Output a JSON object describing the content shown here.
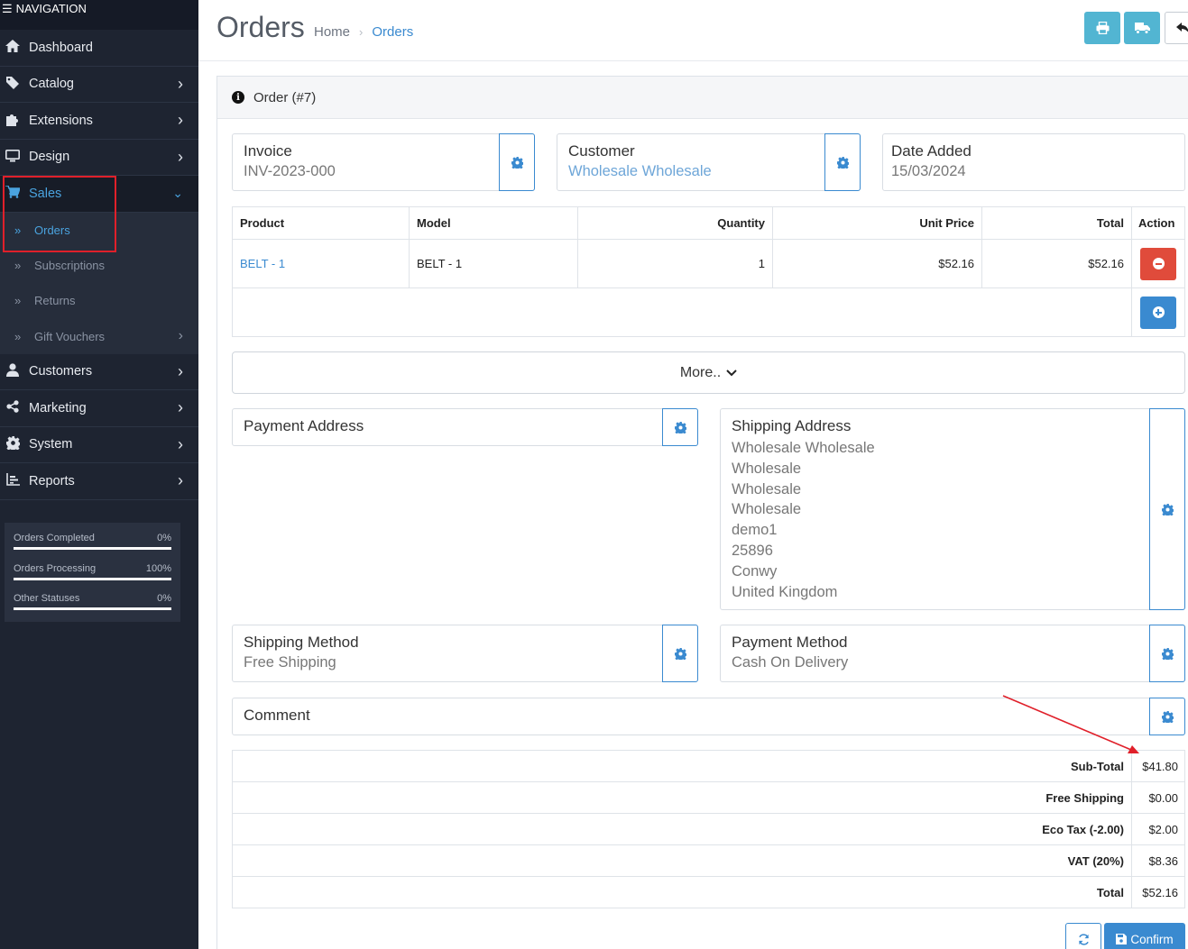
{
  "sidebar": {
    "title": "NAVIGATION",
    "items": [
      {
        "label": "Dashboard",
        "icon": "home-icon"
      },
      {
        "label": "Catalog",
        "icon": "tag-icon"
      },
      {
        "label": "Extensions",
        "icon": "puzzle-icon"
      },
      {
        "label": "Design",
        "icon": "monitor-icon"
      },
      {
        "label": "Sales",
        "icon": "cart-icon"
      },
      {
        "label": "Customers",
        "icon": "user-icon"
      },
      {
        "label": "Marketing",
        "icon": "share-icon"
      },
      {
        "label": "System",
        "icon": "gear-icon"
      },
      {
        "label": "Reports",
        "icon": "chart-icon"
      }
    ],
    "sales_sub": [
      {
        "label": "Orders"
      },
      {
        "label": "Subscriptions"
      },
      {
        "label": "Returns"
      },
      {
        "label": "Gift Vouchers"
      }
    ],
    "stats": [
      {
        "label": "Orders Completed",
        "value": "0%",
        "fraction": 0.0
      },
      {
        "label": "Orders Processing",
        "value": "100%",
        "fraction": 1.0
      },
      {
        "label": "Other Statuses",
        "value": "0%",
        "fraction": 0.0
      }
    ]
  },
  "header": {
    "title": "Orders",
    "breadcrumb": [
      "Home",
      "Orders"
    ]
  },
  "order": {
    "heading": "Order (#7)",
    "invoice": {
      "label": "Invoice",
      "value": "INV-2023-000"
    },
    "customer": {
      "label": "Customer",
      "value": "Wholesale Wholesale"
    },
    "date_added": {
      "label": "Date Added",
      "value": "15/03/2024"
    },
    "columns": [
      "Product",
      "Model",
      "Quantity",
      "Unit Price",
      "Total",
      "Action"
    ],
    "products": [
      {
        "product": "BELT - 1",
        "model": "BELT - 1",
        "quantity": "1",
        "unit_price": "$52.16",
        "total": "$52.16"
      }
    ],
    "more_label": "More..",
    "payment_address": {
      "label": "Payment Address"
    },
    "shipping_address": {
      "label": "Shipping Address",
      "lines": [
        "Wholesale Wholesale",
        "Wholesale",
        "Wholesale",
        "Wholesale",
        "demo1",
        "25896",
        "Conwy",
        "United Kingdom"
      ]
    },
    "shipping_method": {
      "label": "Shipping Method",
      "value": "Free Shipping"
    },
    "payment_method": {
      "label": "Payment Method",
      "value": "Cash On Delivery"
    },
    "comment": {
      "label": "Comment"
    },
    "totals": [
      {
        "label": "Sub-Total",
        "value": "$41.80"
      },
      {
        "label": "Free Shipping",
        "value": "$0.00"
      },
      {
        "label": "Eco Tax (-2.00)",
        "value": "$2.00"
      },
      {
        "label": "VAT (20%)",
        "value": "$8.36"
      },
      {
        "label": "Total",
        "value": "$52.16"
      }
    ],
    "confirm_label": "Confirm"
  },
  "colors": {
    "accent": "#3a8ad0",
    "danger": "#e04b3b",
    "info": "#52b5d2",
    "sidebar": "#1e2431",
    "annotation": "#e0202a"
  }
}
